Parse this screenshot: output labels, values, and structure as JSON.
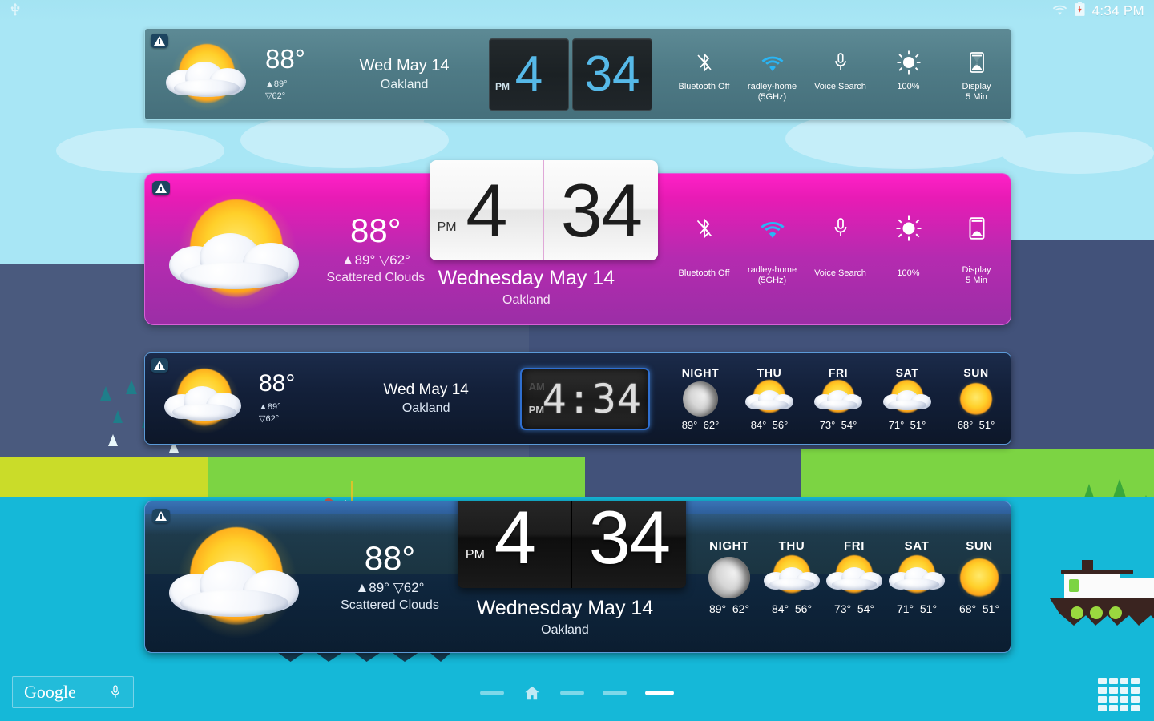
{
  "statusbar": {
    "usb_icon": "usb-icon",
    "wifi_icon": "wifi-icon",
    "battery_icon": "battery-icon",
    "clock": "4:34 PM"
  },
  "common": {
    "temp": "88°",
    "high": "▲89°",
    "low": "▽62°",
    "hilo_inline": "▲89° ▽62°",
    "condition": "Scattered Clouds",
    "city": "Oakland",
    "date_short": "Wed May 14",
    "date_long": "Wednesday May 14",
    "hour": "4",
    "minute": "34",
    "ampm": "PM",
    "lcd_time": "4:34",
    "alert_icon": "weather-alert-icon"
  },
  "toggles": [
    {
      "icon": "bluetooth-off-icon",
      "label": "Bluetooth Off"
    },
    {
      "icon": "wifi-icon",
      "label": "radley-home\n(5GHz)",
      "line1": "radley-home",
      "line2": "(5GHz)"
    },
    {
      "icon": "microphone-icon",
      "label": "Voice Search"
    },
    {
      "icon": "brightness-icon",
      "label": "100%"
    },
    {
      "icon": "hourglass-icon",
      "label": "Display\n5 Min",
      "line1": "Display",
      "line2": "5 Min"
    }
  ],
  "forecast": [
    {
      "day": "NIGHT",
      "icon": "moon-icon",
      "high": "89°",
      "low": "62°"
    },
    {
      "day": "THU",
      "icon": "partly-cloudy-icon",
      "high": "84°",
      "low": "56°"
    },
    {
      "day": "FRI",
      "icon": "partly-cloudy-icon",
      "high": "73°",
      "low": "54°"
    },
    {
      "day": "SAT",
      "icon": "partly-cloudy-icon",
      "high": "71°",
      "low": "51°"
    },
    {
      "day": "SUN",
      "icon": "sunny-icon",
      "high": "68°",
      "low": "51°"
    }
  ],
  "bottom": {
    "google_label": "Google",
    "mic_icon": "microphone-icon",
    "home_icon": "home-icon",
    "app_drawer_icon": "app-drawer-icon",
    "pages": 5,
    "active_page": 5
  },
  "colors": {
    "widget1_bg": "#4f7b86",
    "widget2_bg": "#b52bb0",
    "widget2_top": "#ff21c7",
    "widget3_bg": "#13203a",
    "widget4_bg": "#10263c",
    "accent_blue": "#56b9e8",
    "wifi_blue": "#29b6f6",
    "wallpaper_sky": "#a8e6f5",
    "wallpaper_water": "#15b8d8",
    "wallpaper_mountain": "#4a5a7e",
    "wallpaper_grass_left": "#cadc29",
    "wallpaper_grass_right": "#7cd443",
    "sun": "#ffd02a"
  }
}
